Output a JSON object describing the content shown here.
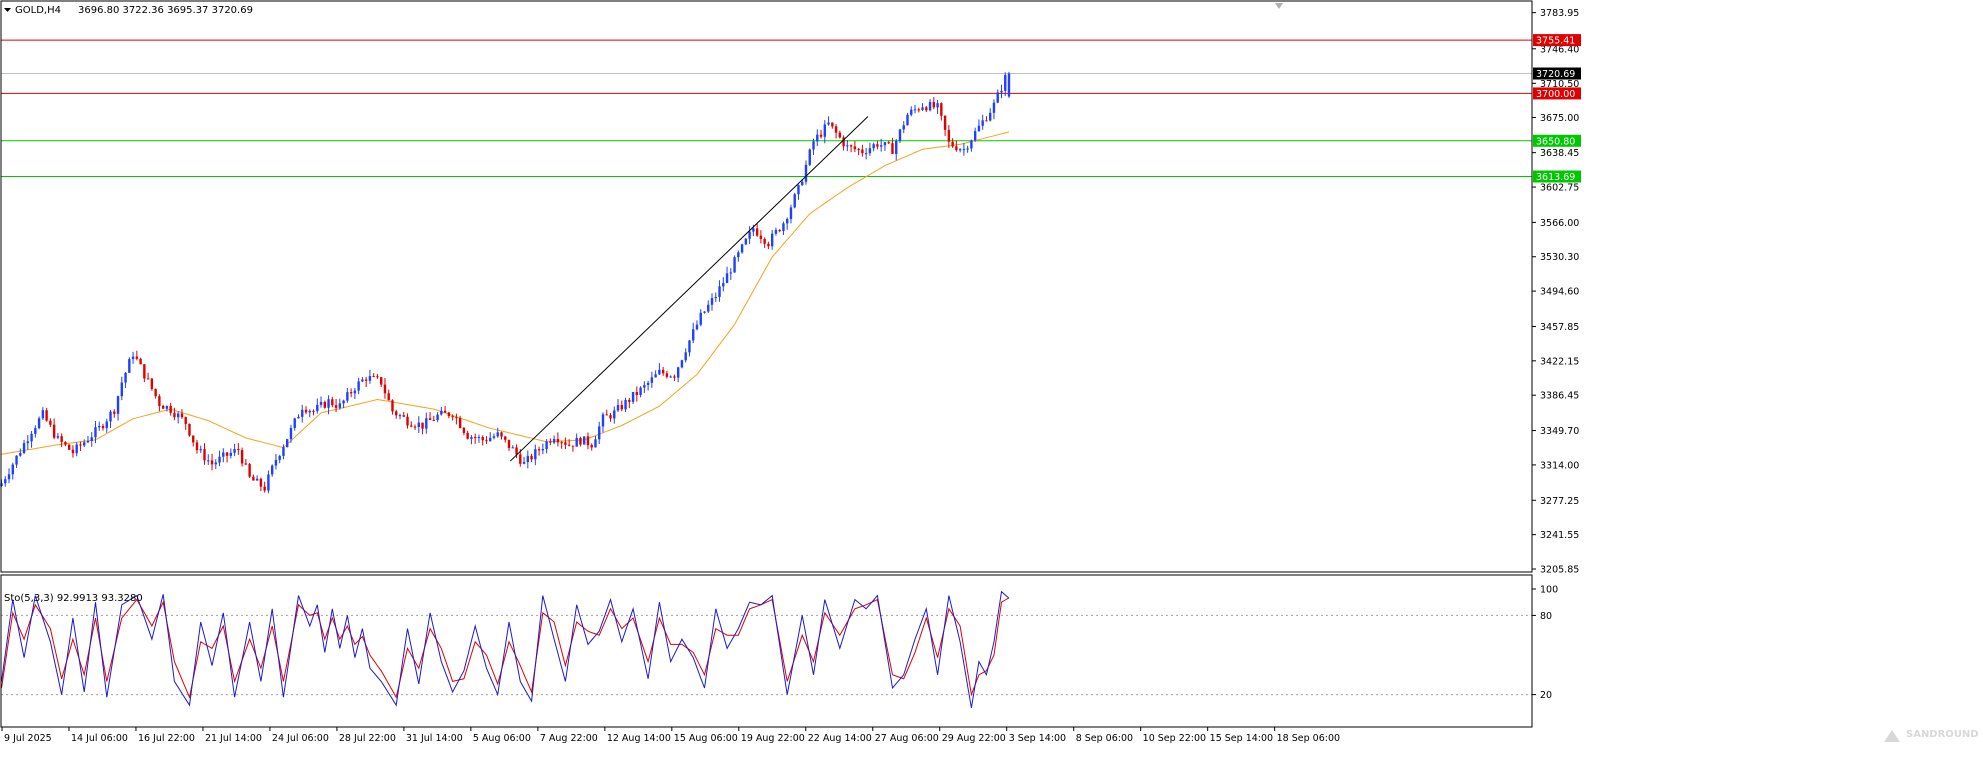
{
  "header": {
    "symbol_label": "GOLD,H4",
    "ohlc": "3696.80 3722.36 3695.37 3720.69"
  },
  "indicator": {
    "label": "Sto(5,3,3) 92.9913 93.3280",
    "levels": [
      100,
      80,
      20
    ],
    "level_labels": [
      "100",
      "80",
      "20"
    ]
  },
  "watermark_text": "SANDROUND",
  "colors": {
    "bull": "#1e40ff",
    "bear": "#e00000",
    "ma": "#f5a21c",
    "resistance": "#e00000",
    "support": "#00c800",
    "trend": "#000000",
    "stoch_main": "#1a1ad6",
    "stoch_signal": "#e00000",
    "price_tag": "#000000"
  },
  "chart_data": {
    "type": "candlestick",
    "symbol": "GOLD",
    "timeframe": "H4",
    "ylim": [
      3205.85,
      3795
    ],
    "y_ticks": [
      "3783.95",
      "3746.40",
      "3710.50",
      "3675.00",
      "3638.45",
      "3602.75",
      "3566.00",
      "3530.30",
      "3494.60",
      "3457.85",
      "3422.15",
      "3386.45",
      "3349.70",
      "3314.00",
      "3277.25",
      "3241.55",
      "3205.85"
    ],
    "x_ticks": [
      "9 Jul 2025",
      "14 Jul 06:00",
      "16 Jul 22:00",
      "21 Jul 14:00",
      "24 Jul 06:00",
      "28 Jul 22:00",
      "31 Jul 14:00",
      "5 Aug 06:00",
      "7 Aug 22:00",
      "12 Aug 14:00",
      "15 Aug 06:00",
      "19 Aug 22:00",
      "22 Aug 14:00",
      "27 Aug 06:00",
      "29 Aug 22:00",
      "3 Sep 14:00",
      "8 Sep 06:00",
      "10 Sep 22:00",
      "15 Sep 14:00",
      "18 Sep 06:00"
    ],
    "current_price": {
      "value": 3720.69,
      "label": "3720.69"
    },
    "horizontal_levels": [
      {
        "value": 3755.41,
        "label": "3755.41",
        "kind": "resistance"
      },
      {
        "value": 3700.0,
        "label": "3700.00",
        "kind": "resistance"
      },
      {
        "value": 3650.8,
        "label": "3650.80",
        "kind": "support"
      },
      {
        "value": 3613.69,
        "label": "3613.69",
        "kind": "support"
      }
    ],
    "trendline": {
      "from": {
        "bar": 0.505,
        "price": 3318
      },
      "to": {
        "bar": 0.86,
        "price": 3676
      }
    },
    "close_path": [
      [
        0,
        3295
      ],
      [
        4,
        3322
      ],
      [
        8,
        3350
      ],
      [
        11,
        3366
      ],
      [
        15,
        3340
      ],
      [
        19,
        3327
      ],
      [
        22,
        3338
      ],
      [
        26,
        3352
      ],
      [
        30,
        3372
      ],
      [
        32,
        3400
      ],
      [
        35,
        3430
      ],
      [
        38,
        3408
      ],
      [
        42,
        3378
      ],
      [
        45,
        3372
      ],
      [
        49,
        3358
      ],
      [
        52,
        3330
      ],
      [
        56,
        3315
      ],
      [
        59,
        3322
      ],
      [
        63,
        3330
      ],
      [
        66,
        3300
      ],
      [
        70,
        3290
      ],
      [
        73,
        3320
      ],
      [
        77,
        3350
      ],
      [
        80,
        3375
      ],
      [
        83,
        3370
      ],
      [
        87,
        3380
      ],
      [
        90,
        3375
      ],
      [
        94,
        3395
      ],
      [
        97,
        3405
      ],
      [
        101,
        3400
      ],
      [
        104,
        3370
      ],
      [
        108,
        3360
      ],
      [
        112,
        3355
      ],
      [
        116,
        3365
      ],
      [
        120,
        3368
      ],
      [
        124,
        3345
      ],
      [
        128,
        3340
      ],
      [
        132,
        3345
      ],
      [
        136,
        3330
      ],
      [
        139,
        3315
      ],
      [
        143,
        3330
      ],
      [
        147,
        3345
      ],
      [
        151,
        3335
      ],
      [
        154,
        3340
      ],
      [
        157,
        3336
      ],
      [
        160,
        3362
      ],
      [
        163,
        3368
      ],
      [
        167,
        3382
      ],
      [
        171,
        3395
      ],
      [
        175,
        3410
      ],
      [
        179,
        3408
      ],
      [
        182,
        3435
      ],
      [
        186,
        3468
      ],
      [
        190,
        3490
      ],
      [
        195,
        3525
      ],
      [
        200,
        3560
      ],
      [
        204,
        3545
      ],
      [
        208,
        3566
      ],
      [
        212,
        3600
      ],
      [
        216,
        3650
      ],
      [
        220,
        3668
      ],
      [
        225,
        3644
      ],
      [
        229,
        3640
      ],
      [
        233,
        3648
      ],
      [
        237,
        3642
      ],
      [
        241,
        3678
      ],
      [
        245,
        3688
      ],
      [
        249,
        3685
      ],
      [
        252,
        3648
      ],
      [
        256,
        3642
      ],
      [
        260,
        3665
      ],
      [
        264,
        3688
      ],
      [
        267,
        3716
      ],
      [
        268,
        3720.69
      ]
    ],
    "ma_path": [
      [
        0,
        3325
      ],
      [
        15,
        3335
      ],
      [
        25,
        3340
      ],
      [
        35,
        3362
      ],
      [
        45,
        3372
      ],
      [
        55,
        3360
      ],
      [
        65,
        3342
      ],
      [
        75,
        3332
      ],
      [
        85,
        3368
      ],
      [
        100,
        3382
      ],
      [
        115,
        3372
      ],
      [
        130,
        3352
      ],
      [
        145,
        3338
      ],
      [
        155,
        3340
      ],
      [
        165,
        3355
      ],
      [
        175,
        3375
      ],
      [
        185,
        3408
      ],
      [
        195,
        3460
      ],
      [
        205,
        3530
      ],
      [
        215,
        3575
      ],
      [
        225,
        3602
      ],
      [
        235,
        3625
      ],
      [
        245,
        3642
      ],
      [
        255,
        3647
      ],
      [
        268,
        3660
      ]
    ],
    "stochastic": {
      "params": "5,3,3",
      "main": 92.9913,
      "signal": 93.328,
      "overbought": 80,
      "oversold": 20,
      "main_path": [
        [
          0,
          30
        ],
        [
          3,
          92
        ],
        [
          6,
          48
        ],
        [
          9,
          95
        ],
        [
          13,
          60
        ],
        [
          16,
          20
        ],
        [
          19,
          78
        ],
        [
          22,
          22
        ],
        [
          25,
          90
        ],
        [
          28,
          18
        ],
        [
          32,
          88
        ],
        [
          36,
          95
        ],
        [
          40,
          62
        ],
        [
          43,
          96
        ],
        [
          46,
          30
        ],
        [
          50,
          12
        ],
        [
          53,
          75
        ],
        [
          56,
          42
        ],
        [
          59,
          82
        ],
        [
          62,
          18
        ],
        [
          66,
          75
        ],
        [
          69,
          30
        ],
        [
          72,
          85
        ],
        [
          75,
          18
        ],
        [
          79,
          95
        ],
        [
          82,
          72
        ],
        [
          84,
          88
        ],
        [
          86,
          52
        ],
        [
          88,
          85
        ],
        [
          90,
          55
        ],
        [
          92,
          80
        ],
        [
          94,
          48
        ],
        [
          96,
          70
        ],
        [
          98,
          40
        ],
        [
          101,
          30
        ],
        [
          105,
          12
        ],
        [
          108,
          70
        ],
        [
          111,
          28
        ],
        [
          114,
          82
        ],
        [
          117,
          45
        ],
        [
          120,
          22
        ],
        [
          123,
          38
        ],
        [
          126,
          72
        ],
        [
          129,
          40
        ],
        [
          132,
          20
        ],
        [
          135,
          75
        ],
        [
          138,
          30
        ],
        [
          141,
          15
        ],
        [
          144,
          95
        ],
        [
          147,
          62
        ],
        [
          150,
          30
        ],
        [
          153,
          88
        ],
        [
          156,
          58
        ],
        [
          159,
          68
        ],
        [
          162,
          92
        ],
        [
          165,
          60
        ],
        [
          168,
          85
        ],
        [
          172,
          32
        ],
        [
          175,
          90
        ],
        [
          178,
          45
        ],
        [
          181,
          62
        ],
        [
          184,
          48
        ],
        [
          187,
          25
        ],
        [
          190,
          85
        ],
        [
          193,
          55
        ],
        [
          196,
          70
        ],
        [
          199,
          90
        ],
        [
          202,
          88
        ],
        [
          205,
          95
        ],
        [
          209,
          20
        ],
        [
          213,
          80
        ],
        [
          216,
          35
        ],
        [
          219,
          92
        ],
        [
          223,
          55
        ],
        [
          227,
          92
        ],
        [
          230,
          85
        ],
        [
          233,
          95
        ],
        [
          237,
          25
        ],
        [
          240,
          35
        ],
        [
          243,
          62
        ],
        [
          246,
          85
        ],
        [
          249,
          35
        ],
        [
          252,
          95
        ],
        [
          255,
          60
        ],
        [
          258,
          10
        ],
        [
          260,
          45
        ],
        [
          262,
          35
        ],
        [
          264,
          60
        ],
        [
          266,
          98
        ],
        [
          268,
          93
        ]
      ],
      "signal_path": [
        [
          0,
          25
        ],
        [
          3,
          82
        ],
        [
          6,
          62
        ],
        [
          9,
          88
        ],
        [
          13,
          70
        ],
        [
          16,
          32
        ],
        [
          19,
          62
        ],
        [
          22,
          35
        ],
        [
          25,
          78
        ],
        [
          28,
          30
        ],
        [
          32,
          78
        ],
        [
          36,
          92
        ],
        [
          40,
          72
        ],
        [
          43,
          90
        ],
        [
          46,
          45
        ],
        [
          50,
          18
        ],
        [
          53,
          60
        ],
        [
          56,
          55
        ],
        [
          59,
          72
        ],
        [
          62,
          30
        ],
        [
          66,
          62
        ],
        [
          69,
          40
        ],
        [
          72,
          72
        ],
        [
          75,
          30
        ],
        [
          79,
          88
        ],
        [
          82,
          80
        ],
        [
          84,
          82
        ],
        [
          86,
          62
        ],
        [
          88,
          78
        ],
        [
          90,
          62
        ],
        [
          92,
          72
        ],
        [
          94,
          58
        ],
        [
          96,
          64
        ],
        [
          98,
          50
        ],
        [
          101,
          38
        ],
        [
          105,
          18
        ],
        [
          108,
          55
        ],
        [
          111,
          40
        ],
        [
          114,
          70
        ],
        [
          117,
          55
        ],
        [
          120,
          30
        ],
        [
          123,
          32
        ],
        [
          126,
          60
        ],
        [
          129,
          50
        ],
        [
          132,
          28
        ],
        [
          135,
          60
        ],
        [
          138,
          42
        ],
        [
          141,
          22
        ],
        [
          144,
          82
        ],
        [
          147,
          75
        ],
        [
          150,
          42
        ],
        [
          153,
          75
        ],
        [
          156,
          68
        ],
        [
          159,
          65
        ],
        [
          162,
          85
        ],
        [
          165,
          70
        ],
        [
          168,
          78
        ],
        [
          172,
          45
        ],
        [
          175,
          78
        ],
        [
          178,
          58
        ],
        [
          181,
          58
        ],
        [
          184,
          52
        ],
        [
          187,
          35
        ],
        [
          190,
          70
        ],
        [
          193,
          65
        ],
        [
          196,
          65
        ],
        [
          199,
          85
        ],
        [
          202,
          88
        ],
        [
          205,
          92
        ],
        [
          209,
          30
        ],
        [
          213,
          65
        ],
        [
          216,
          45
        ],
        [
          219,
          82
        ],
        [
          223,
          65
        ],
        [
          227,
          85
        ],
        [
          230,
          88
        ],
        [
          233,
          92
        ],
        [
          237,
          35
        ],
        [
          240,
          32
        ],
        [
          243,
          52
        ],
        [
          246,
          78
        ],
        [
          249,
          48
        ],
        [
          252,
          85
        ],
        [
          255,
          72
        ],
        [
          258,
          20
        ],
        [
          260,
          35
        ],
        [
          262,
          38
        ],
        [
          264,
          50
        ],
        [
          266,
          90
        ],
        [
          268,
          93.33
        ]
      ]
    }
  }
}
